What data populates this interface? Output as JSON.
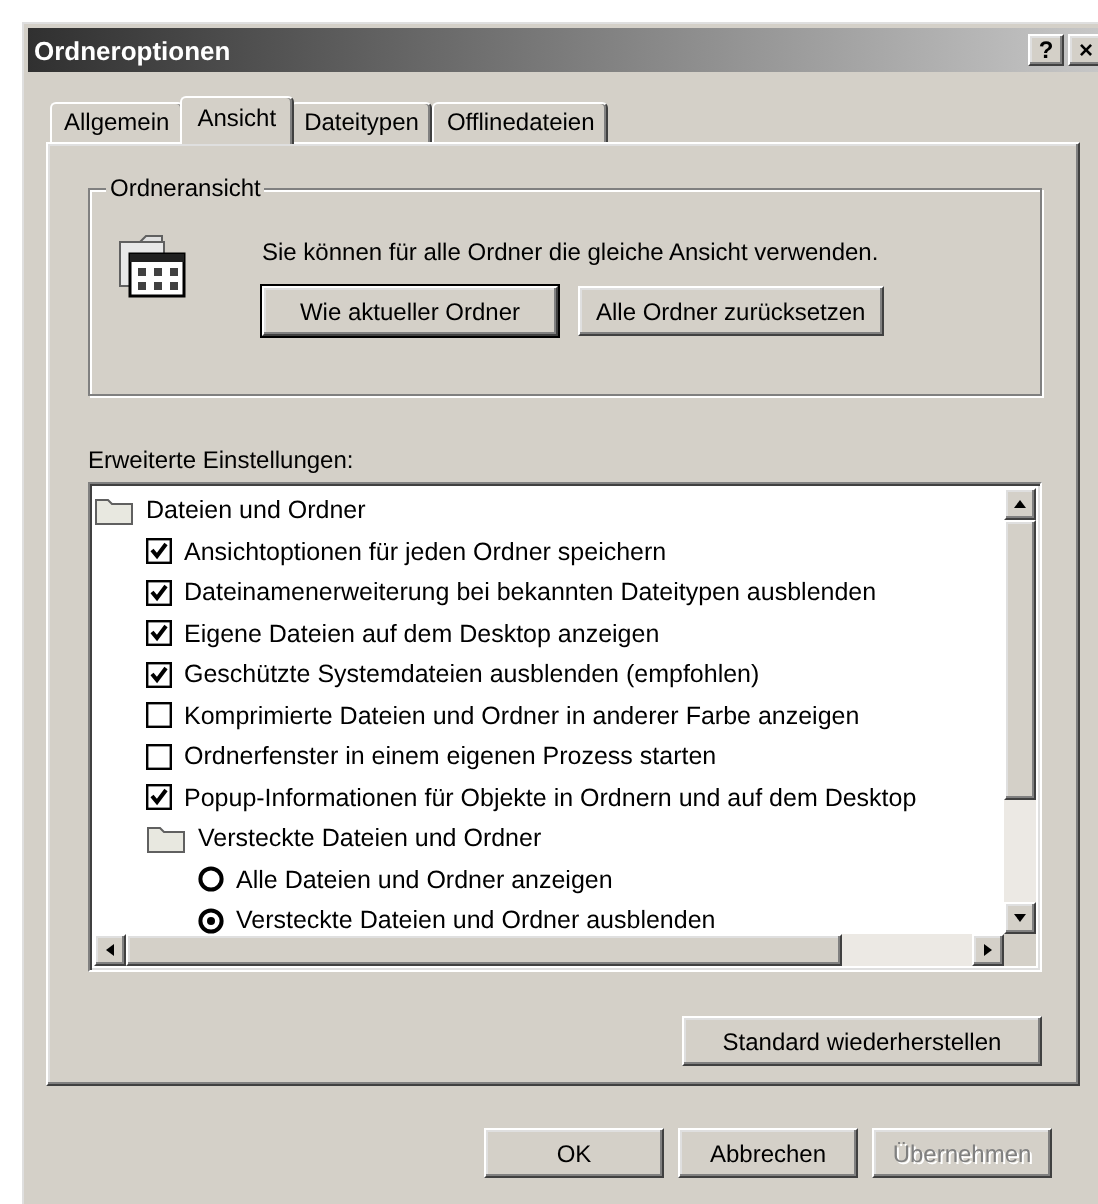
{
  "window": {
    "title": "Ordneroptionen",
    "controls": [
      "?",
      "×"
    ]
  },
  "tabs": [
    {
      "label": "Allgemein",
      "selected": false
    },
    {
      "label": "Ansicht",
      "selected": true
    },
    {
      "label": "Dateitypen",
      "selected": false
    },
    {
      "label": "Offlinedateien",
      "selected": false
    }
  ],
  "folder_view": {
    "title": "Ordneransicht",
    "text": "Sie können für alle Ordner die gleiche Ansicht verwenden.",
    "buttons": [
      {
        "label": "Wie aktueller Ordner",
        "default": true
      },
      {
        "label": "Alle Ordner zurücksetzen",
        "default": false
      }
    ]
  },
  "advanced": {
    "label": "Erweiterte Einstellungen:",
    "tree": [
      {
        "kind": "folder",
        "label": "Dateien und Ordner",
        "children": [
          {
            "kind": "checkbox",
            "label": "Ansichtoptionen für jeden Ordner speichern",
            "checked": true
          },
          {
            "kind": "checkbox",
            "label": "Dateinamenerweiterung bei bekannten Dateitypen ausblenden",
            "checked": true
          },
          {
            "kind": "checkbox",
            "label": "Eigene Dateien auf dem Desktop anzeigen",
            "checked": true
          },
          {
            "kind": "checkbox",
            "label": "Geschützte Systemdateien ausblenden (empfohlen)",
            "checked": true
          },
          {
            "kind": "checkbox",
            "label": "Komprimierte Dateien und Ordner in anderer Farbe anzeigen",
            "checked": false
          },
          {
            "kind": "checkbox",
            "label": "Ordnerfenster in einem eigenen Prozess starten",
            "checked": false
          },
          {
            "kind": "checkbox",
            "label": "Popup-Informationen für Objekte in Ordnern und auf dem Desktop",
            "checked": true
          },
          {
            "kind": "folder",
            "label": "Versteckte Dateien und Ordner",
            "children": [
              {
                "kind": "radio",
                "label": "Alle Dateien und Ordner anzeigen",
                "selected": false
              },
              {
                "kind": "radio",
                "label": "Versteckte Dateien und Ordner ausblenden",
                "selected": true
              }
            ]
          }
        ]
      }
    ],
    "restore_button": "Standard wiederherstellen"
  },
  "buttons": [
    {
      "label": "OK",
      "disabled": false
    },
    {
      "label": "Abbrechen",
      "disabled": false
    },
    {
      "label": "Übernehmen",
      "disabled": true
    }
  ]
}
